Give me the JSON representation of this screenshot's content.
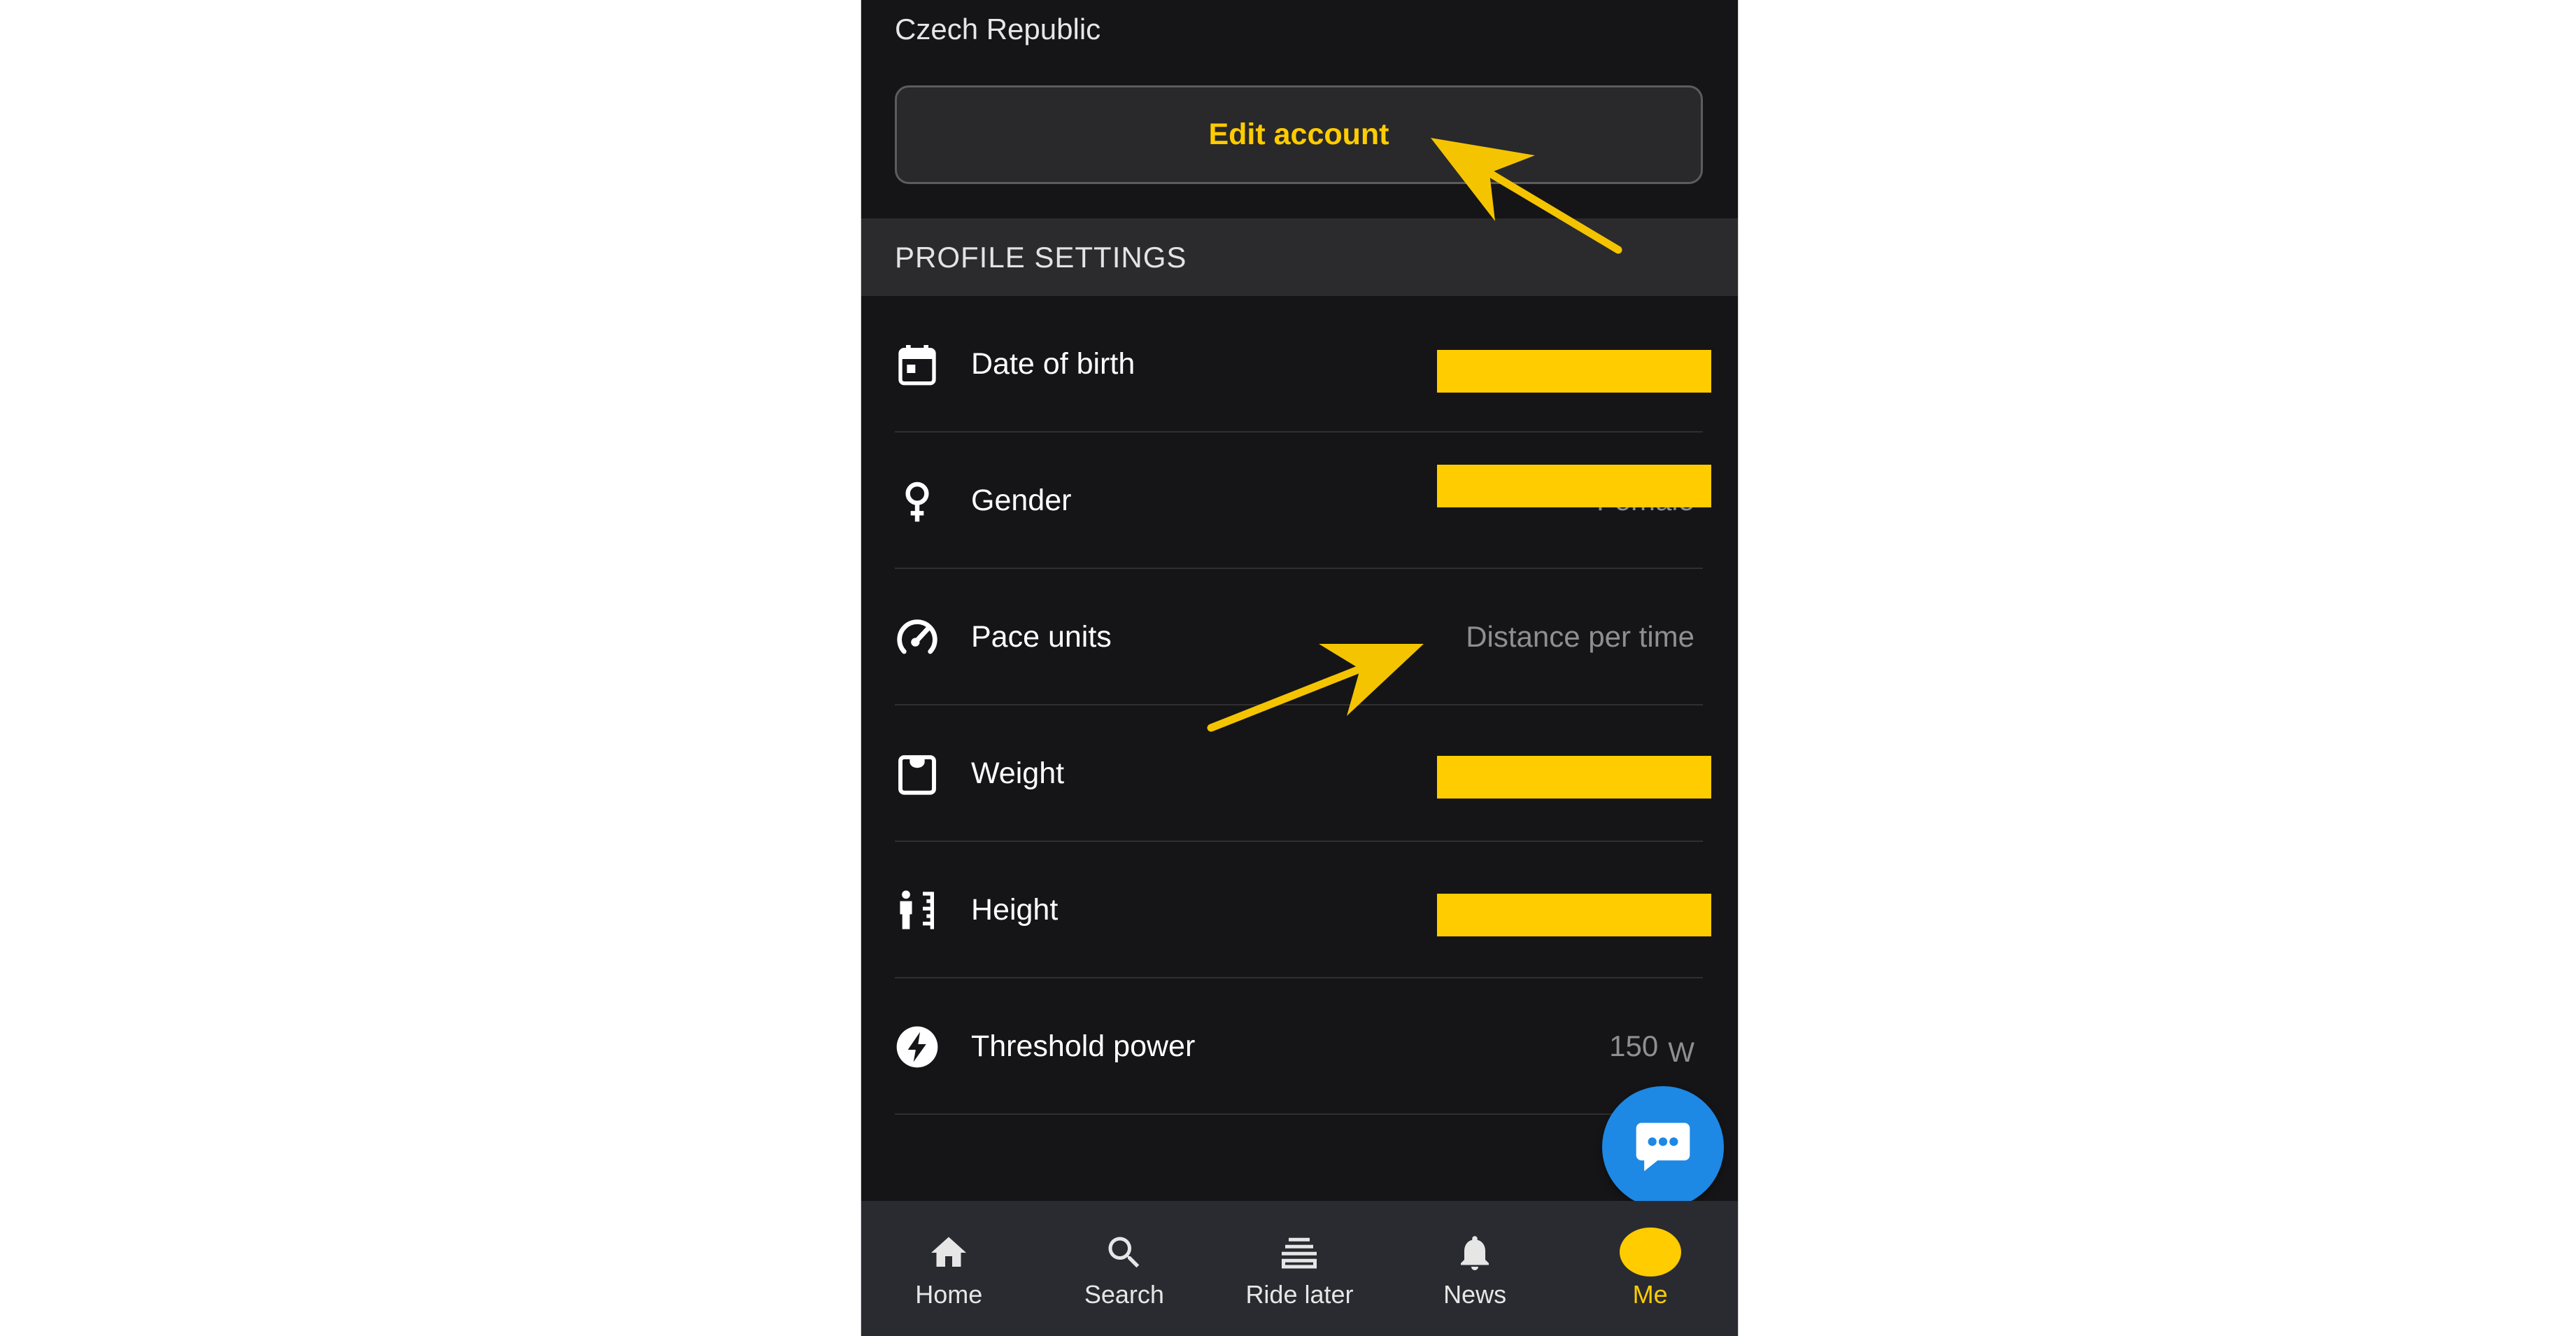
{
  "header": {
    "country": "Czech Republic",
    "edit_account_label": "Edit account"
  },
  "section": {
    "title": "PROFILE SETTINGS"
  },
  "settings": [
    {
      "label": "Date of birth",
      "icon": "calendar-icon",
      "redacted": true
    },
    {
      "label": "Gender",
      "icon": "gender-female-icon",
      "value": "Female",
      "redacted": true
    },
    {
      "label": "Pace units",
      "icon": "speedometer-icon",
      "value": "Distance per time"
    },
    {
      "label": "Weight",
      "icon": "weight-icon",
      "redacted": true
    },
    {
      "label": "Height",
      "icon": "height-icon",
      "redacted": true
    },
    {
      "label": "Threshold power",
      "icon": "lightning-bolt-icon",
      "value": "150",
      "unit": "W"
    }
  ],
  "chat_button": {
    "icon": "chat-bubble-icon"
  },
  "nav": {
    "active_index": 4,
    "items": [
      {
        "label": "Home",
        "icon": "home-icon"
      },
      {
        "label": "Search",
        "icon": "search-icon"
      },
      {
        "label": "Ride later",
        "icon": "ride-later-list-icon"
      },
      {
        "label": "News",
        "icon": "bell-icon"
      },
      {
        "label": "Me",
        "icon": "avatar"
      }
    ]
  },
  "colors": {
    "accent": "#ffcc00",
    "background": "#151517",
    "section_header": "#2b2b2d",
    "nav_bar": "#2a2b30",
    "fab": "#1e88e5",
    "value_text": "#8e8e93",
    "annotation_arrow": "#f5c400"
  }
}
